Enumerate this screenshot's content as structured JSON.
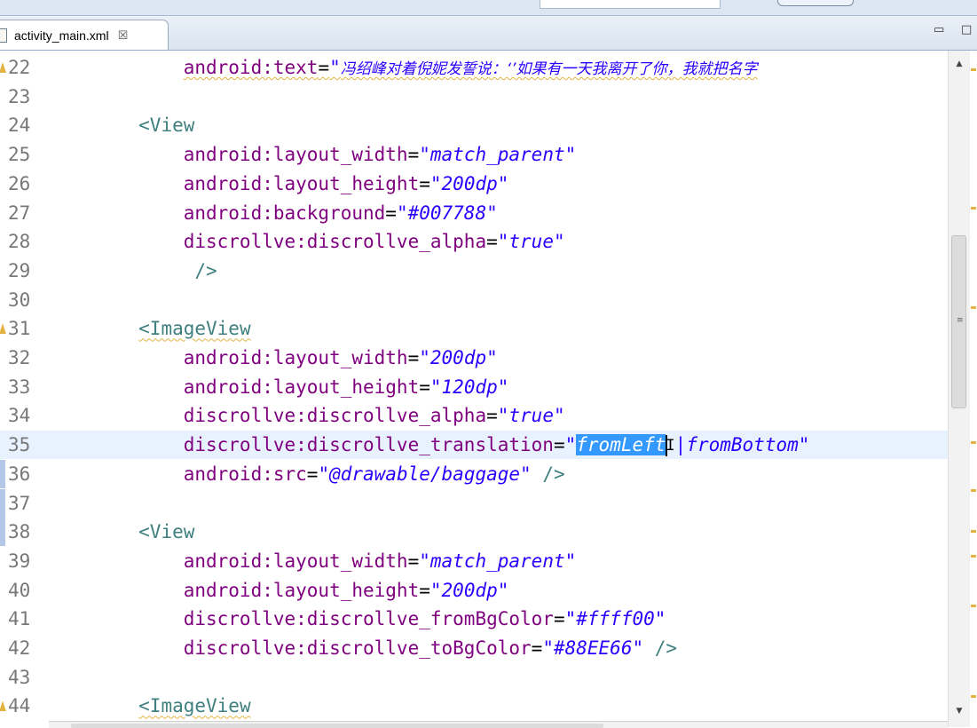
{
  "tab": {
    "title": "activity_main.xml",
    "close_glyph": "☒"
  },
  "window_controls": {
    "minimize": "▭",
    "maximize": "□"
  },
  "lines": [
    {
      "n": "22",
      "warn": true,
      "parts": [
        {
          "t": "            "
        },
        {
          "t": "android:text",
          "c": "attr",
          "squig": true
        },
        {
          "t": "=",
          "c": "eq",
          "squig": true
        },
        {
          "t": "\"",
          "c": "str",
          "squig": true
        },
        {
          "t": "冯绍峰对着倪妮发誓说：‘’如果有一天我离开了你，我就把名字",
          "c": "str cn",
          "squig": true
        }
      ]
    },
    {
      "n": "23",
      "parts": []
    },
    {
      "n": "24",
      "parts": [
        {
          "t": "        "
        },
        {
          "t": "<View",
          "c": "tag"
        }
      ]
    },
    {
      "n": "25",
      "parts": [
        {
          "t": "            "
        },
        {
          "t": "android:layout_width",
          "c": "attr"
        },
        {
          "t": "=",
          "c": "eq"
        },
        {
          "t": "\"match_parent\"",
          "c": "str"
        }
      ]
    },
    {
      "n": "26",
      "parts": [
        {
          "t": "            "
        },
        {
          "t": "android:layout_height",
          "c": "attr"
        },
        {
          "t": "=",
          "c": "eq"
        },
        {
          "t": "\"200dp\"",
          "c": "str"
        }
      ]
    },
    {
      "n": "27",
      "parts": [
        {
          "t": "            "
        },
        {
          "t": "android:background",
          "c": "attr"
        },
        {
          "t": "=",
          "c": "eq"
        },
        {
          "t": "\"#007788\"",
          "c": "str"
        }
      ]
    },
    {
      "n": "28",
      "parts": [
        {
          "t": "            "
        },
        {
          "t": "discrollve:discrollve_alpha",
          "c": "attr"
        },
        {
          "t": "=",
          "c": "eq"
        },
        {
          "t": "\"true\"",
          "c": "str"
        }
      ]
    },
    {
      "n": "29",
      "parts": [
        {
          "t": "             "
        },
        {
          "t": "/>",
          "c": "tag"
        }
      ]
    },
    {
      "n": "30",
      "parts": []
    },
    {
      "n": "31",
      "warn": true,
      "parts": [
        {
          "t": "        "
        },
        {
          "t": "<ImageView",
          "c": "tag",
          "squig": true
        }
      ]
    },
    {
      "n": "32",
      "parts": [
        {
          "t": "            "
        },
        {
          "t": "android:layout_width",
          "c": "attr"
        },
        {
          "t": "=",
          "c": "eq"
        },
        {
          "t": "\"200dp\"",
          "c": "str"
        }
      ]
    },
    {
      "n": "33",
      "parts": [
        {
          "t": "            "
        },
        {
          "t": "android:layout_height",
          "c": "attr"
        },
        {
          "t": "=",
          "c": "eq"
        },
        {
          "t": "\"120dp\"",
          "c": "str"
        }
      ]
    },
    {
      "n": "34",
      "parts": [
        {
          "t": "            "
        },
        {
          "t": "discrollve:discrollve_alpha",
          "c": "attr"
        },
        {
          "t": "=",
          "c": "eq"
        },
        {
          "t": "\"true\"",
          "c": "str"
        }
      ]
    },
    {
      "n": "35",
      "current": true,
      "parts": [
        {
          "t": "            "
        },
        {
          "t": "discrollve:discrollve_translation",
          "c": "attr"
        },
        {
          "t": "=",
          "c": "eq"
        },
        {
          "t": "\"",
          "c": "str"
        },
        {
          "t": "fromLeft",
          "c": "str sel"
        },
        {
          "caret": true
        },
        {
          "t": "|fromBottom\"",
          "c": "str"
        }
      ]
    },
    {
      "n": "36",
      "changed": true,
      "parts": [
        {
          "t": "            "
        },
        {
          "t": "android:src",
          "c": "attr"
        },
        {
          "t": "=",
          "c": "eq"
        },
        {
          "t": "\"@drawable/baggage\"",
          "c": "str"
        },
        {
          "t": " "
        },
        {
          "t": "/>",
          "c": "tag"
        }
      ]
    },
    {
      "n": "37",
      "changed": true,
      "parts": []
    },
    {
      "n": "38",
      "changed": true,
      "parts": [
        {
          "t": "        "
        },
        {
          "t": "<View",
          "c": "tag"
        }
      ]
    },
    {
      "n": "39",
      "parts": [
        {
          "t": "            "
        },
        {
          "t": "android:layout_width",
          "c": "attr"
        },
        {
          "t": "=",
          "c": "eq"
        },
        {
          "t": "\"match_parent\"",
          "c": "str"
        }
      ]
    },
    {
      "n": "40",
      "parts": [
        {
          "t": "            "
        },
        {
          "t": "android:layout_height",
          "c": "attr"
        },
        {
          "t": "=",
          "c": "eq"
        },
        {
          "t": "\"200dp\"",
          "c": "str"
        }
      ]
    },
    {
      "n": "41",
      "parts": [
        {
          "t": "            "
        },
        {
          "t": "discrollve:discrollve_fromBgColor",
          "c": "attr"
        },
        {
          "t": "=",
          "c": "eq"
        },
        {
          "t": "\"#ffff00\"",
          "c": "str"
        }
      ]
    },
    {
      "n": "42",
      "parts": [
        {
          "t": "            "
        },
        {
          "t": "discrollve:discrollve_toBgColor",
          "c": "attr"
        },
        {
          "t": "=",
          "c": "eq"
        },
        {
          "t": "\"#88EE66\"",
          "c": "str"
        },
        {
          "t": " "
        },
        {
          "t": "/>",
          "c": "tag"
        }
      ]
    },
    {
      "n": "43",
      "parts": []
    },
    {
      "n": "44",
      "warn": true,
      "parts": [
        {
          "t": "        "
        },
        {
          "t": "<ImageView",
          "c": "tag",
          "squig": true
        }
      ]
    }
  ],
  "colors": {
    "attribute": "#7f007f",
    "string": "#2a00ff",
    "tag": "#3f7f7f",
    "selection": "#3399ff",
    "current_line": "#e8f2fe"
  },
  "icons": {
    "file": "xml-file-icon",
    "warning": "warning-icon",
    "scroll_up": "scroll-up-arrow-icon",
    "scroll_down": "scroll-down-arrow-icon",
    "grip": "scroll-grip-icon"
  }
}
